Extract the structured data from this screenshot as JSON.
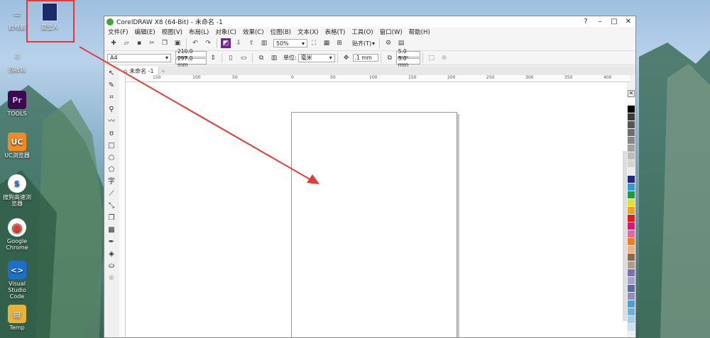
{
  "desktop": {
    "icons": [
      {
        "label": "此电脑",
        "glyph": "▭",
        "color": "#3a78d6"
      },
      {
        "label": "回收站",
        "glyph": "♲",
        "color": "#6e8fb0"
      },
      {
        "label": "TOOLS",
        "glyph": "Pr",
        "color": "#3a0a4d"
      },
      {
        "label": "UC浏览器",
        "glyph": "UC",
        "color": "#f08a24"
      },
      {
        "label": "搜狗高速浏览器",
        "glyph": "S",
        "color": "#1f7ae0"
      },
      {
        "label": "Google Chrome",
        "glyph": "◉",
        "color": "#e2a21a"
      },
      {
        "label": "Visual Studio Code",
        "glyph": "<>",
        "color": "#1e6fc8"
      },
      {
        "label": "Temp",
        "glyph": "▤",
        "color": "#e6b23a"
      }
    ],
    "selected_icon_label": "蓝宝人"
  },
  "window": {
    "title": "CorelDRAW X8 (64-Bit) - 未命名 -1",
    "controls": {
      "help": "?",
      "minimize": "–",
      "maximize": "□",
      "close": "✕"
    },
    "menu": [
      "文件(F)",
      "编辑(E)",
      "视图(V)",
      "布局(L)",
      "对象(C)",
      "效果(C)",
      "位图(B)",
      "文本(X)",
      "表格(T)",
      "工具(O)",
      "窗口(W)",
      "帮助(H)"
    ],
    "toolbar": {
      "zoom": "50%",
      "snap": "贴齐(T)"
    },
    "props": {
      "page_size": "A4",
      "width": "210.0 mm",
      "height": "297.0 mm",
      "unit_label": "单位:",
      "unit": "毫米",
      "nudge": ".1 mm",
      "dup_x": "5.0 mm",
      "dup_y": "5.0 mm"
    },
    "doc_tab": "未命名 -1",
    "ruler_ticks": [
      "150",
      "100",
      "50",
      "0",
      "50",
      "100",
      "150",
      "200",
      "250",
      "300",
      "350",
      "400"
    ]
  },
  "palette_colors": [
    "#ffffff",
    "#000000",
    "#3a3a3a",
    "#555555",
    "#6e6e6e",
    "#888888",
    "#a0a0a0",
    "#bbbbbb",
    "#d4d4d4",
    "#ececec",
    "#1d2a8c",
    "#2c9bd9",
    "#1f9b3a",
    "#e8e02a",
    "#f0a020",
    "#e31b1b",
    "#d8197a",
    "#e36aa0",
    "#f07e1b",
    "#f0b27a",
    "#8a6a4a",
    "#b09a8a",
    "#7a70b0",
    "#a79fd0",
    "#5f6aa0",
    "#8f8fbf",
    "#4aa0d0",
    "#6ab0e0",
    "#9fd0e8",
    "#c8e0f0"
  ]
}
